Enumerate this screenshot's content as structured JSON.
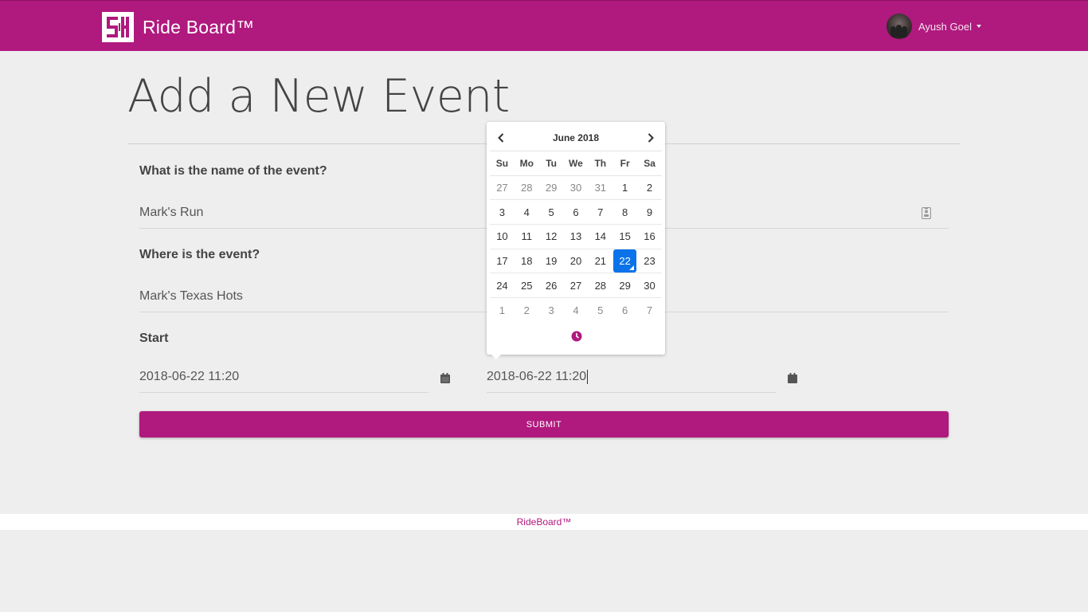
{
  "navbar": {
    "brand_name": "Ride Board™",
    "user_name": "Ayush Goel",
    "color": "#b0197e"
  },
  "page": {
    "title": "Add a New Event"
  },
  "form": {
    "name_label": "What is the name of the event?",
    "name_value": "Mark's Run",
    "location_label": "Where is the event?",
    "location_value": "Mark's Texas Hots",
    "start_label": "Start",
    "start_value": "2018-06-22 11:20",
    "end_value": "2018-06-22 11:20",
    "submit_label": "Submit"
  },
  "datepicker": {
    "month_label": "June 2018",
    "weekdays": [
      "Su",
      "Mo",
      "Tu",
      "We",
      "Th",
      "Fr",
      "Sa"
    ],
    "weeks": [
      [
        "27",
        "28",
        "29",
        "30",
        "31",
        "1",
        "2"
      ],
      [
        "3",
        "4",
        "5",
        "6",
        "7",
        "8",
        "9"
      ],
      [
        "10",
        "11",
        "12",
        "13",
        "14",
        "15",
        "16"
      ],
      [
        "17",
        "18",
        "19",
        "20",
        "21",
        "22",
        "23"
      ],
      [
        "24",
        "25",
        "26",
        "27",
        "28",
        "29",
        "30"
      ],
      [
        "1",
        "2",
        "3",
        "4",
        "5",
        "6",
        "7"
      ]
    ],
    "selected_day": "22",
    "selected_color": "#0a73ea"
  },
  "footer": {
    "text": "RideBoard™"
  },
  "icons": [
    "brand-logo-icon",
    "chevron-left-icon",
    "chevron-right-icon",
    "clock-icon",
    "calendar-icon",
    "contact-card-icon",
    "caret-down-icon"
  ]
}
